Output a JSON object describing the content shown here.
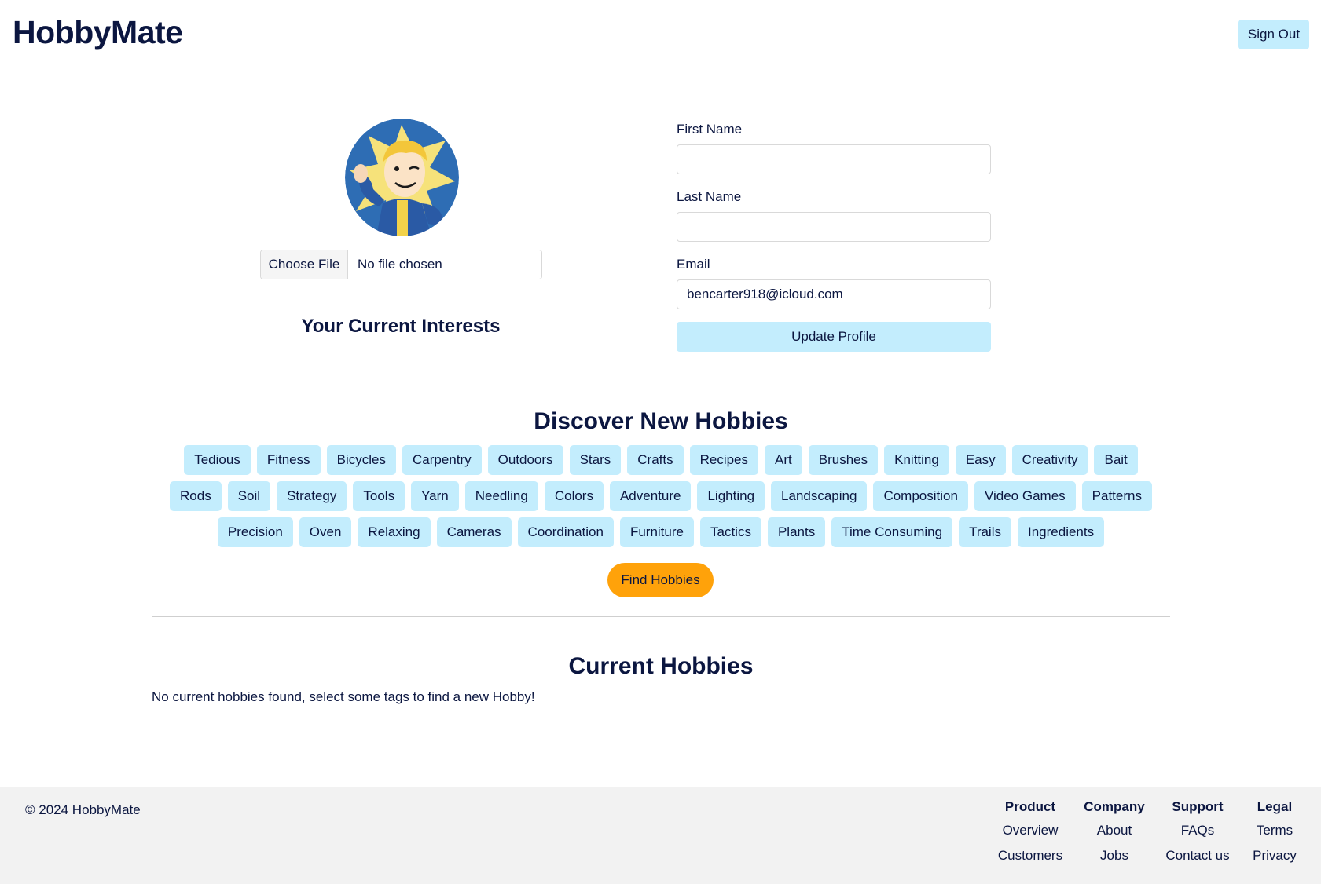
{
  "header": {
    "logo": "HobbyMate",
    "sign_out_label": "Sign Out"
  },
  "profile": {
    "avatar_alt": "avatar",
    "file_button_label": "Choose File",
    "file_status": "No file chosen",
    "interests_title": "Your Current Interests",
    "first_name_label": "First Name",
    "first_name_value": "",
    "last_name_label": "Last Name",
    "last_name_value": "",
    "email_label": "Email",
    "email_value": "bencarter918@icloud.com",
    "update_label": "Update Profile"
  },
  "discover": {
    "title": "Discover New Hobbies",
    "tags": [
      "Tedious",
      "Fitness",
      "Bicycles",
      "Carpentry",
      "Outdoors",
      "Stars",
      "Crafts",
      "Recipes",
      "Art",
      "Brushes",
      "Knitting",
      "Easy",
      "Creativity",
      "Bait",
      "Rods",
      "Soil",
      "Strategy",
      "Tools",
      "Yarn",
      "Needling",
      "Colors",
      "Adventure",
      "Lighting",
      "Landscaping",
      "Composition",
      "Video Games",
      "Patterns",
      "Precision",
      "Oven",
      "Relaxing",
      "Cameras",
      "Coordination",
      "Furniture",
      "Tactics",
      "Plants",
      "Time Consuming",
      "Trails",
      "Ingredients"
    ],
    "find_label": "Find Hobbies"
  },
  "current": {
    "title": "Current Hobbies",
    "empty_message": "No current hobbies found, select some tags to find a new Hobby!"
  },
  "footer": {
    "copyright": "© 2024 HobbyMate",
    "columns": [
      {
        "heading": "Product",
        "links": [
          "Overview",
          "Customers"
        ]
      },
      {
        "heading": "Company",
        "links": [
          "About",
          "Jobs"
        ]
      },
      {
        "heading": "Support",
        "links": [
          "FAQs",
          "Contact us"
        ]
      },
      {
        "heading": "Legal",
        "links": [
          "Terms",
          "Privacy"
        ]
      }
    ]
  },
  "colors": {
    "accent_light_blue": "#c3edfd",
    "find_orange": "#ffa20a",
    "text_navy": "#0b1640",
    "footer_bg": "#f2f2f2"
  }
}
